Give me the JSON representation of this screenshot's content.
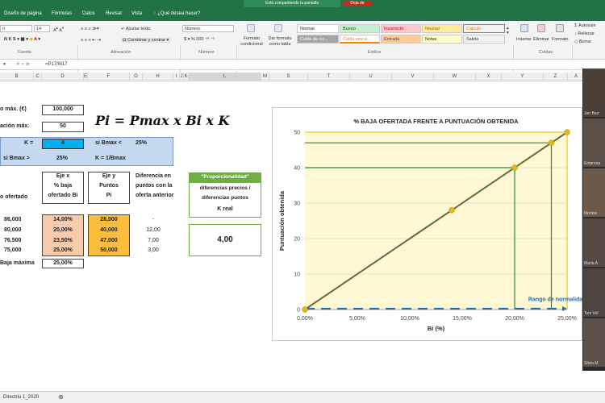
{
  "titlebar": {
    "share_text": "Está compartiendo la pantalla",
    "stop_label": "Deja de"
  },
  "tabs": [
    "Diseño de página",
    "Fórmulas",
    "Datos",
    "Revisar",
    "Vista",
    "¿Qué desea hacer?"
  ],
  "ribbon": {
    "font_name": "ri",
    "font_size": "14",
    "wrap_text": "Ajustar texto",
    "merge_center": "Combinar y centrar",
    "number_format": "Número",
    "cond_format": "Formato condicional",
    "table_format": "Dar formato como tabla",
    "styles": {
      "normal": "Normal",
      "bueno": "Bueno",
      "incorrecto": "Incorrecto",
      "neutral": "Neutral",
      "calculo": "Cálculo",
      "celda_co": "Celda de co...",
      "celda_vinc": "Celda vincul...",
      "entrada": "Entrada",
      "notas": "Notas",
      "salida": "Salida"
    },
    "insert": "Insertar",
    "delete": "Eliminar",
    "format": "Formato",
    "autosum": "Autosum",
    "fill": "Rellenar",
    "clear": "Borrar",
    "groups": {
      "font": "Fuente",
      "alignment": "Alineación",
      "number": "Número",
      "styles": "Estilos",
      "cells": "Celdas"
    }
  },
  "formula_bar": {
    "fx": "fx",
    "content": "=P17/M17"
  },
  "columns": [
    "B",
    "C",
    "D",
    "E",
    "F",
    "G",
    "H",
    "I",
    "J",
    "K",
    "L",
    "M",
    "S",
    "T",
    "U",
    "V",
    "W",
    "X",
    "Y",
    "Z",
    "A"
  ],
  "sheet": {
    "pmax_label": "o máx. (€)",
    "pmax_value": "100,000",
    "pun_label": "ación máx.",
    "pun_value": "50",
    "k_label": "K =",
    "k_value": "4",
    "si_bmax_lt": "si Bmax <",
    "si_bmax_lt_value": "25%",
    "si_bmax_gt": "si Bmax >",
    "si_bmax_gt_value": "25%",
    "k_formula": "K = 1/Bmax",
    "formula": "Pi = Pmax x Bi x K",
    "hdr_ofertado": "o ofertado",
    "hdr_ejex": [
      "Eje x",
      "% baja",
      "ofertado Bi"
    ],
    "hdr_ejey": [
      "Eje y",
      "Puntos",
      "Pi"
    ],
    "hdr_dif": [
      "Diferencia en",
      "puntos con la",
      "oferta anterior"
    ],
    "prop_title": "\"Proporcionalidad\"",
    "prop_sub": [
      "diferencias precios /",
      "diferencias puntos"
    ],
    "k_real_label": "K real",
    "k_real_value": "4,00",
    "rows": [
      {
        "price": "86,000",
        "bi": "14,00%",
        "pi": "28,000",
        "dif": "-"
      },
      {
        "price": "80,000",
        "bi": "20,00%",
        "pi": "40,000",
        "dif": "12,00"
      },
      {
        "price": "76,500",
        "bi": "23,50%",
        "pi": "47,000",
        "dif": "7,00"
      },
      {
        "price": "75,000",
        "bi": "25,00%",
        "pi": "50,000",
        "dif": "3,00"
      }
    ],
    "baja_max_label": "Baja máxima",
    "baja_max_value": "25,00%"
  },
  "chart_data": {
    "type": "scatter",
    "title": "% BAJA OFERTADA FRENTE A PUNTUACIÓN OBTENIDA",
    "xlabel": "Bi (%)",
    "ylabel": "Puntuación obtenida",
    "xlim": [
      0,
      25
    ],
    "ylim": [
      0,
      50
    ],
    "x_ticks": [
      "0,00%",
      "5,00%",
      "10,00%",
      "15,00%",
      "20,00%",
      "25,00%"
    ],
    "y_ticks": [
      "0",
      "10",
      "20",
      "30",
      "40",
      "50"
    ],
    "annotation": "Rango de normalidad",
    "series": [
      {
        "values": [
          [
            0,
            0
          ],
          [
            14,
            28
          ],
          [
            20,
            40
          ],
          [
            23.5,
            47
          ],
          [
            25,
            50
          ]
        ]
      }
    ],
    "colors": {
      "line": "#2f8a3e",
      "dash": "#c0392b",
      "marker": "#e0b820",
      "range": "#1f6fb5",
      "shade": "#fdf3b0"
    }
  },
  "participants": [
    "Jan Barr",
    "Empresa",
    "Montse",
    "Maria A",
    "Toni Vel",
    "Silvia M"
  ],
  "sheet_tab": "Directriu 1_2020",
  "colors": {
    "excel_green": "#217346",
    "k_blue": "#c5d9f1",
    "k_cyan": "#00b0f0",
    "orange": "#fbbd3c",
    "pink": "#f8cbad"
  }
}
